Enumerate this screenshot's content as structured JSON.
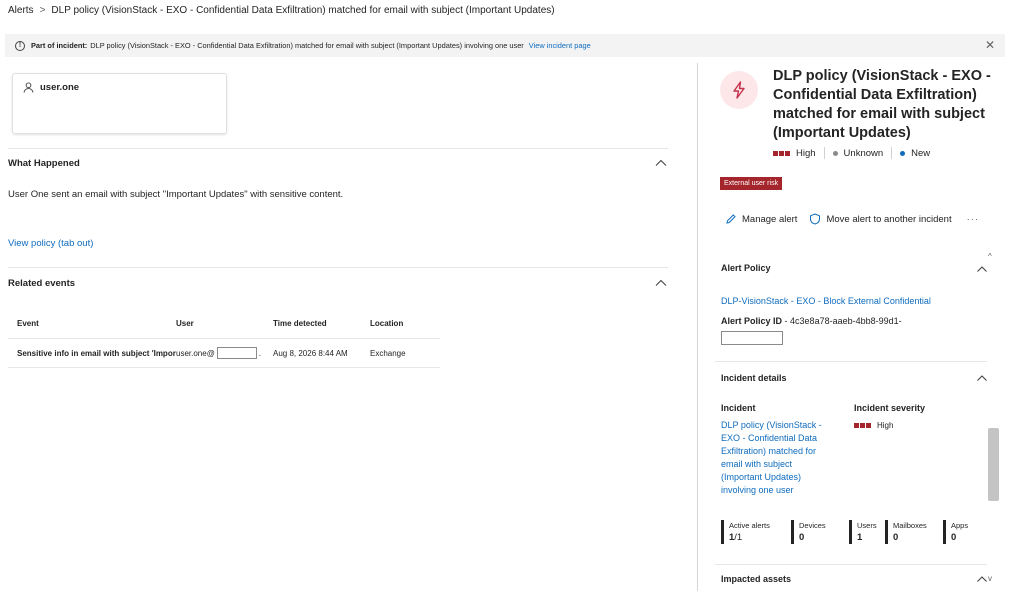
{
  "breadcrumb": {
    "root": "Alerts",
    "separator": ">",
    "current": "DLP policy (VisionStack - EXO - Confidential Data Exfiltration) matched for email with subject (Important Updates)"
  },
  "banner": {
    "prefix": "Part of incident:",
    "text": "DLP policy (VisionStack - EXO - Confidential Data Exfiltration) matched for email with subject (Important Updates) involving one user",
    "link": "View incident page"
  },
  "user_card": {
    "name": "user.one"
  },
  "what_happened": {
    "title": "What Happened",
    "description": "User One sent an email with subject \"Important Updates\" with sensitive content.",
    "link": "View policy (tab out)"
  },
  "related_events": {
    "title": "Related events",
    "columns": [
      "Event",
      "User",
      "Time detected",
      "Location"
    ],
    "rows": [
      {
        "event": "Sensitive info in email with subject 'Impor",
        "user_prefix": "user.one@",
        "user_suffix": ".",
        "time": "Aug 8, 2026 8:44 AM",
        "location": "Exchange"
      }
    ]
  },
  "panel": {
    "title": "DLP policy (VisionStack - EXO - Confidential Data Exfiltration) matched for email with subject (Important Updates)",
    "severity": "High",
    "classification": "Unknown",
    "status": "New",
    "badge": "External user risk",
    "actions": {
      "manage": "Manage alert",
      "move": "Move alert to another incident"
    },
    "alert_policy": {
      "title": "Alert Policy",
      "policy_link": "DLP-VisionStack - EXO - Block External Confidential",
      "id_label": "Alert Policy ID",
      "id_value": "- 4c3e8a78-aaeb-4bb8-99d1-"
    },
    "incident_details": {
      "title": "Incident details",
      "incident_label": "Incident",
      "severity_label": "Incident severity",
      "incident_name": "DLP policy (VisionStack - EXO - Confidential Data Exfiltration) matched for email with subject (Important Updates) involving one user",
      "severity_value": "High",
      "counts": [
        {
          "label": "Active alerts",
          "value": "1",
          "denominator": "/1"
        },
        {
          "label": "Devices",
          "value": "0"
        },
        {
          "label": "Users",
          "value": "1"
        },
        {
          "label": "Mailboxes",
          "value": "0"
        },
        {
          "label": "Apps",
          "value": "0"
        }
      ]
    },
    "impacted_assets": {
      "title": "Impacted assets"
    }
  },
  "colors": {
    "accent": "#0f6cbd",
    "severity_high": "#a4262c",
    "status_new": "#0f6cbd",
    "unknown_dot": "#8a8a8a",
    "alert_icon_bg": "#fde7e9"
  }
}
